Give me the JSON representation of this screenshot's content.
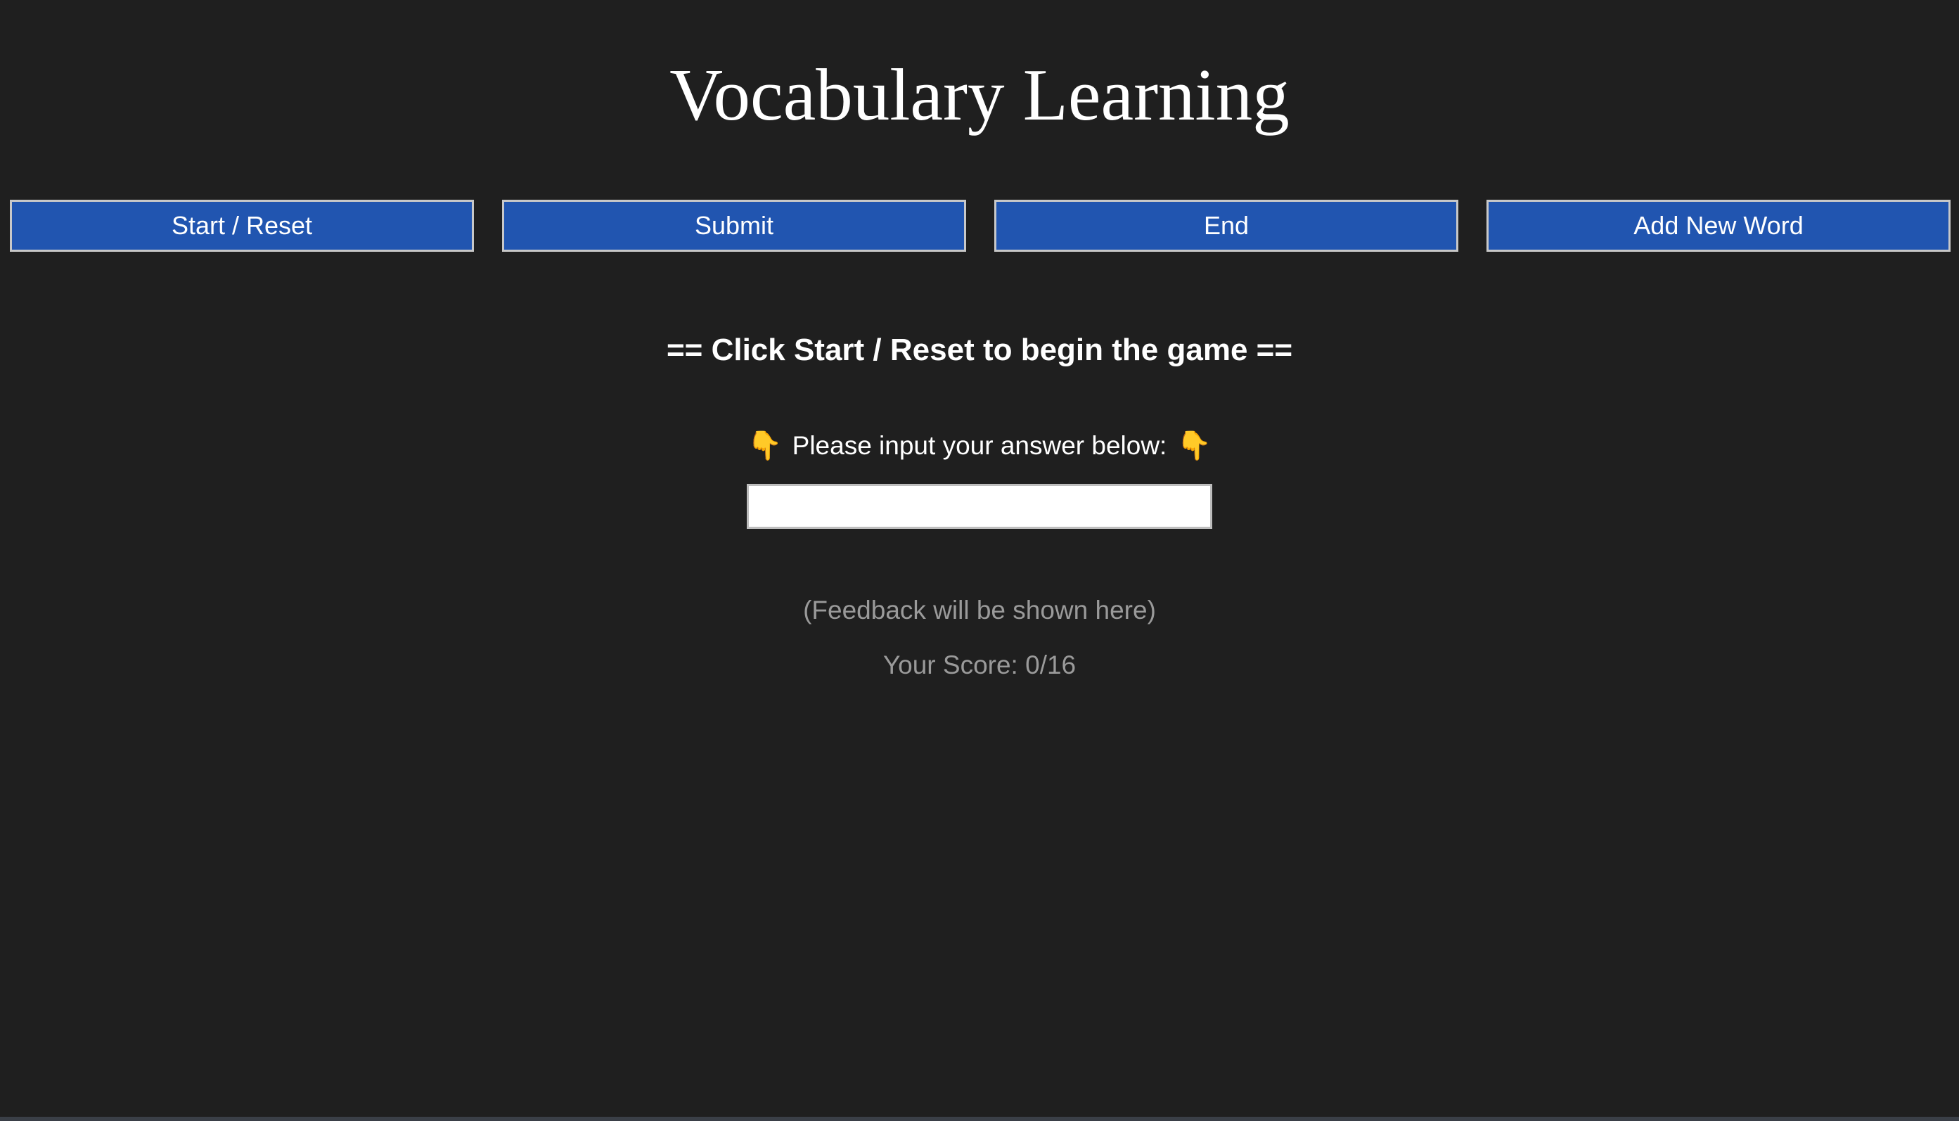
{
  "title": "Vocabulary Learning",
  "buttons": {
    "start_reset": "Start / Reset",
    "submit": "Submit",
    "end": "End",
    "add_new_word": "Add New Word"
  },
  "status_message": "== Click Start / Reset to begin the game ==",
  "prompt": {
    "hand_icon": "👇",
    "text": "Please input your answer below:"
  },
  "answer_input": {
    "value": "",
    "placeholder": ""
  },
  "feedback": "(Feedback will be shown here)",
  "score_text": "Your Score: 0/16",
  "colors": {
    "background": "#1f1f1f",
    "button": "#2155b0",
    "muted_text": "#9a9a9a"
  },
  "icons": {
    "prompt_icon": "pointing-down-hand-icon"
  }
}
